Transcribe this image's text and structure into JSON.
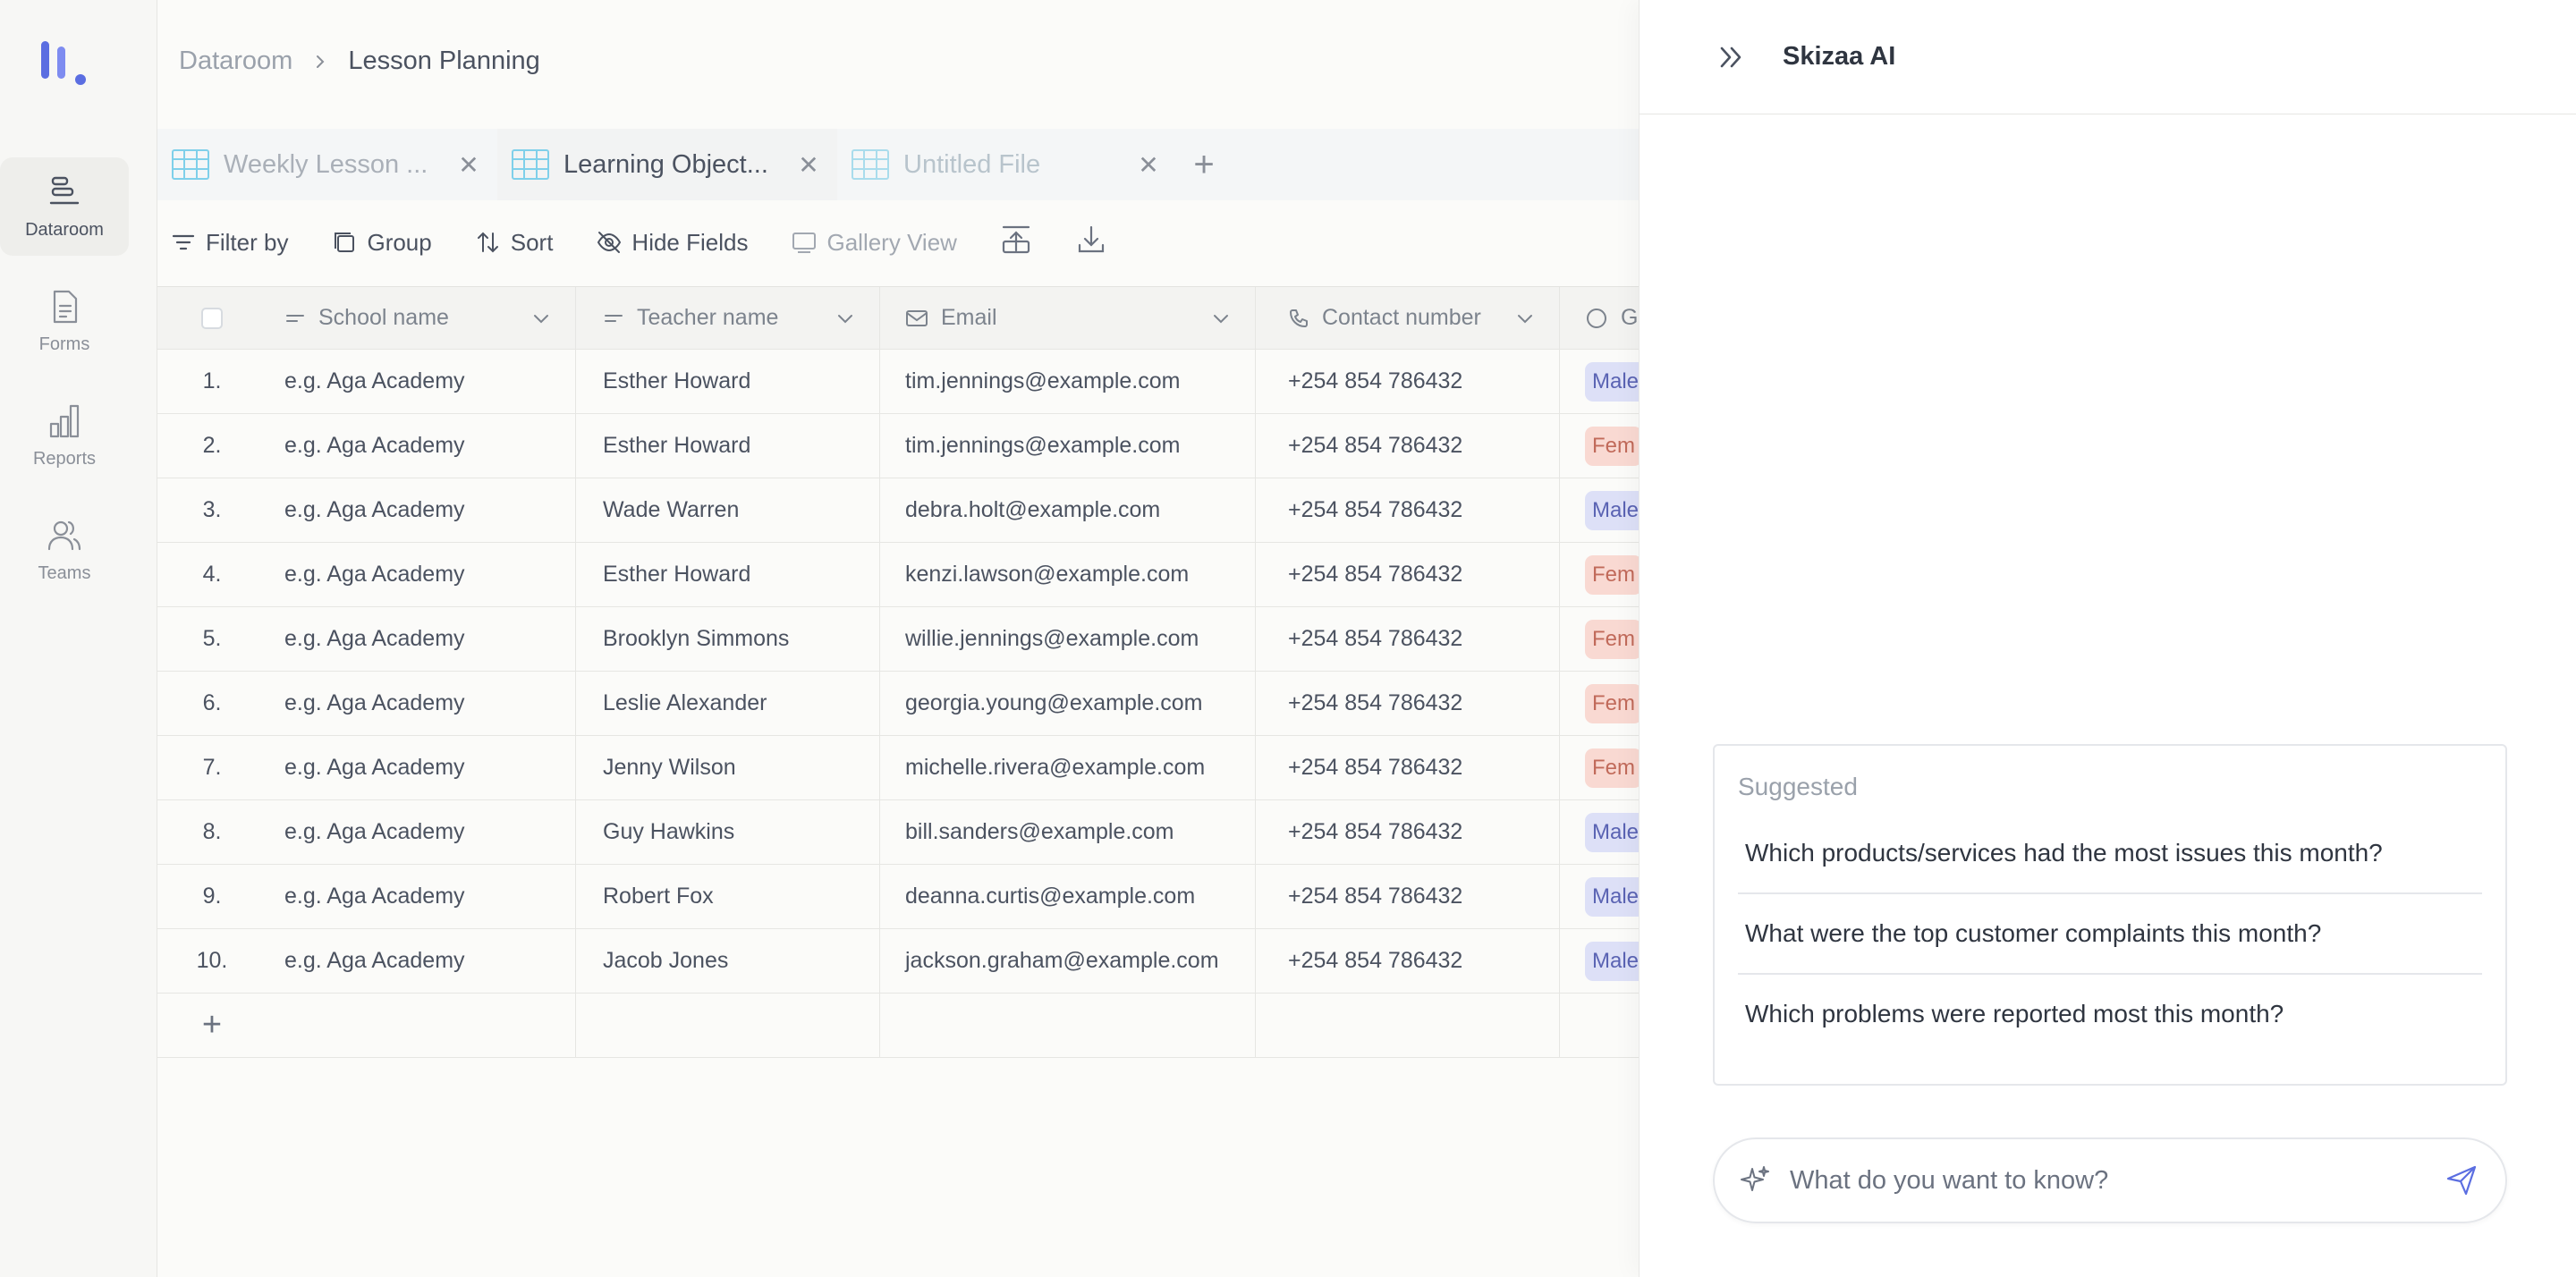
{
  "sidebar": {
    "items": [
      {
        "label": "Dataroom",
        "icon": "dataroom-icon",
        "active": true
      },
      {
        "label": "Forms",
        "icon": "forms-icon"
      },
      {
        "label": "Reports",
        "icon": "reports-icon"
      },
      {
        "label": "Teams",
        "icon": "teams-icon"
      }
    ]
  },
  "breadcrumb": {
    "root": "Dataroom",
    "current": "Lesson Planning"
  },
  "tabs": [
    {
      "label": "Weekly Lesson ..."
    },
    {
      "label": "Learning Object..."
    },
    {
      "label": "Untitled File"
    }
  ],
  "toolbar": {
    "filter": "Filter by",
    "group": "Group",
    "sort": "Sort",
    "hide_fields": "Hide Fields",
    "gallery_view": "Gallery View"
  },
  "table": {
    "columns": [
      "School name",
      "Teacher name",
      "Email",
      "Contact number",
      "G"
    ],
    "rows": [
      {
        "idx": "1.",
        "school": "e.g. Aga Academy",
        "teacher": "Esther Howard",
        "email": "tim.jennings@example.com",
        "contact": "+254 854 786432",
        "gender": "Male"
      },
      {
        "idx": "2.",
        "school": "e.g. Aga Academy",
        "teacher": "Esther Howard",
        "email": "tim.jennings@example.com",
        "contact": "+254 854 786432",
        "gender": "Fem"
      },
      {
        "idx": "3.",
        "school": "e.g. Aga Academy",
        "teacher": "Wade Warren",
        "email": "debra.holt@example.com",
        "contact": "+254 854 786432",
        "gender": "Male"
      },
      {
        "idx": "4.",
        "school": "e.g. Aga Academy",
        "teacher": "Esther Howard",
        "email": "kenzi.lawson@example.com",
        "contact": "+254 854 786432",
        "gender": "Fem"
      },
      {
        "idx": "5.",
        "school": "e.g. Aga Academy",
        "teacher": "Brooklyn Simmons",
        "email": "willie.jennings@example.com",
        "contact": "+254 854 786432",
        "gender": "Fem"
      },
      {
        "idx": "6.",
        "school": "e.g. Aga Academy",
        "teacher": "Leslie Alexander",
        "email": "georgia.young@example.com",
        "contact": "+254 854 786432",
        "gender": "Fem"
      },
      {
        "idx": "7.",
        "school": "e.g. Aga Academy",
        "teacher": "Jenny Wilson",
        "email": "michelle.rivera@example.com",
        "contact": "+254 854 786432",
        "gender": "Fem"
      },
      {
        "idx": "8.",
        "school": "e.g. Aga Academy",
        "teacher": "Guy Hawkins",
        "email": "bill.sanders@example.com",
        "contact": "+254 854 786432",
        "gender": "Male"
      },
      {
        "idx": "9.",
        "school": "e.g. Aga Academy",
        "teacher": "Robert Fox",
        "email": "deanna.curtis@example.com",
        "contact": "+254 854 786432",
        "gender": "Male"
      },
      {
        "idx": "10.",
        "school": "e.g. Aga Academy",
        "teacher": "Jacob Jones",
        "email": "jackson.graham@example.com",
        "contact": "+254 854 786432",
        "gender": "Male"
      }
    ]
  },
  "ai_panel": {
    "title": "Skizaa AI",
    "suggested_title": "Suggested",
    "suggestions": [
      "Which products/services had the most issues this month?",
      "What were the top customer complaints this month?",
      "Which problems were reported most this month?"
    ],
    "input_placeholder": "What do you want to know?"
  },
  "colors": {
    "accent": "#5b6ee1",
    "male_pill": "#dde0f7",
    "female_pill": "#f9d9d2"
  }
}
